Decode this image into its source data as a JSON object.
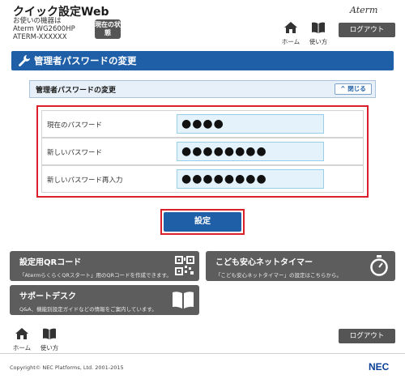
{
  "header": {
    "app_title": "クイック設定Web",
    "device_label": "お使いの機器は",
    "device_model": "Aterm WG2600HP",
    "device_ssid": "ATERM-XXXXXX",
    "status_button": "現在の状態",
    "logo": "Aterm",
    "home_label": "ホーム",
    "usage_label": "使い方",
    "logout_label": "ログアウト"
  },
  "page": {
    "title": "管理者パスワードの変更",
    "section_title": "管理者パスワードの変更",
    "close_label": "閉じる"
  },
  "form": {
    "current_password_label": "現在のパスワード",
    "current_password_value": "●●●●",
    "new_password_label": "新しいパスワード",
    "new_password_value": "●●●●●●●●",
    "confirm_password_label": "新しいパスワード再入力",
    "confirm_password_value": "●●●●●●●●",
    "submit_label": "設定"
  },
  "cards": {
    "qr_title": "設定用QRコード",
    "qr_desc": "「AtermらくらくQRスタート」用のQRコードを作成できます。",
    "timer_title": "こども安心ネットタイマー",
    "timer_desc": "「こども安心ネットタイマー」の設定はこちらから。",
    "support_title": "サポートデスク",
    "support_desc": "Q&A、機能別設定ガイドなどの情報をご案内しています。"
  },
  "footer": {
    "home_label": "ホーム",
    "usage_label": "使い方",
    "logout_label": "ログアウト",
    "copyright": "Copyright© NEC Platforms, Ltd. 2001-2015",
    "brand": "NEC"
  },
  "colors": {
    "primary_blue": "#1f5fa8",
    "highlight_red": "#d9202b",
    "card_gray": "#5d5d5d"
  },
  "icons": [
    "home-icon",
    "book-icon",
    "wrench-icon",
    "chevron-up-icon",
    "qr-code-icon",
    "stopwatch-icon"
  ]
}
